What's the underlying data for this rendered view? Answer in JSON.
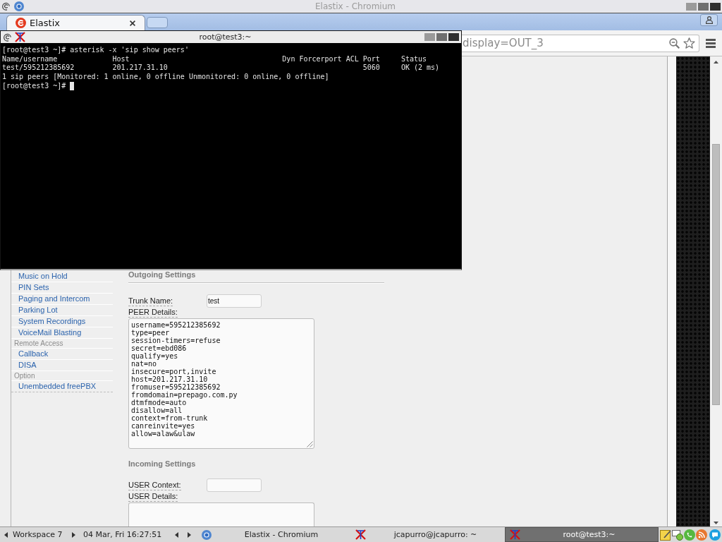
{
  "browser_window": {
    "title": "Elastix - Chromium"
  },
  "tabs": [
    {
      "label": "Elastix",
      "selected": true
    }
  ],
  "address_bar": {
    "value": "display=OUT_3"
  },
  "terminal_window": {
    "title": "root@test3:~",
    "lines": [
      "[root@test3 ~]# asterisk -x 'sip show peers'",
      "Name/username             Host                                    Dyn Forcerport ACL Port     Status",
      "test/595212385692         201.217.31.10                                              5060     OK (2 ms)",
      "1 sip peers [Monitored: 1 online, 0 offline Unmonitored: 0 online, 0 offline]",
      "[root@test3 ~]#"
    ]
  },
  "sidebar": {
    "items": [
      {
        "kind": "link",
        "label": "Music on Hold"
      },
      {
        "kind": "link",
        "label": "PIN Sets"
      },
      {
        "kind": "link",
        "label": "Paging and Intercom"
      },
      {
        "kind": "link",
        "label": "Parking Lot"
      },
      {
        "kind": "link",
        "label": "System Recordings"
      },
      {
        "kind": "link",
        "label": "VoiceMail Blasting"
      },
      {
        "kind": "header",
        "label": "Remote Access"
      },
      {
        "kind": "link",
        "label": "Callback"
      },
      {
        "kind": "link",
        "label": "DISA"
      },
      {
        "kind": "header",
        "label": "Option"
      },
      {
        "kind": "link",
        "label": "Unembedded freePBX"
      }
    ]
  },
  "form": {
    "sections": [
      {
        "title": "Outgoing Settings",
        "fields": [
          {
            "kind": "input",
            "label": "Trunk Name:",
            "value": "test"
          },
          {
            "kind": "textarea",
            "label": "PEER Details:",
            "value": "username=595212385692\ntype=peer\nsession-timers=refuse\nsecret=ebd086\nqualify=yes\nnat=no\ninsecure=port,invite\nhost=201.217.31.10\nfromuser=595212385692\nfromdomain=prepago.com.py\ndtmfmode=auto\ndisallow=all\ncontext=from-trunk\ncanreinvite=yes\nallow=alaw&ulaw"
          }
        ]
      },
      {
        "title": "Incoming Settings",
        "fields": [
          {
            "kind": "input",
            "label": "USER Context:"
          },
          {
            "kind": "textarea",
            "label": "USER Details:"
          }
        ]
      }
    ]
  },
  "taskbar": {
    "workspace": "Workspace 7",
    "clock": "04 Mar, Fri 16:27:51",
    "tasks": [
      {
        "kind": "browser",
        "label": "Elastix - Chromium",
        "selected": false
      },
      {
        "kind": "terminal",
        "label": "jcapurro@jcapurro: ~",
        "selected": false
      },
      {
        "kind": "terminal",
        "label": "root@test3:~",
        "selected": true
      }
    ]
  }
}
